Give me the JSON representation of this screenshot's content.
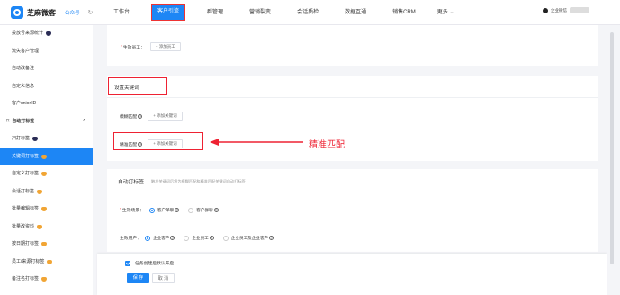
{
  "header": {
    "brand": "芝麻微客",
    "brand_sub": "公众号",
    "nav": [
      {
        "label": "工作台"
      },
      {
        "label": "客户引流"
      },
      {
        "label": "群管理"
      },
      {
        "label": "营销裂变"
      },
      {
        "label": "会话质检"
      },
      {
        "label": "数据互通"
      },
      {
        "label": "销售CRM"
      }
    ],
    "more_label": "更多",
    "user_name": "企业微信"
  },
  "sidebar": {
    "items": [
      {
        "label": "投放号来源统计",
        "badge": "dark"
      },
      {
        "label": "流失客户管理"
      },
      {
        "label": "自动改备注"
      },
      {
        "label": "自定义信息"
      },
      {
        "label": "客户unionID"
      },
      {
        "label": "自动打标签",
        "group": true
      },
      {
        "label": "扫打标签",
        "badge": "dark"
      },
      {
        "label": "关键词打标签",
        "badge": "orange",
        "active": true
      },
      {
        "label": "自定义打标签",
        "badge": "orange"
      },
      {
        "label": "会话打标签",
        "badge": "orange"
      },
      {
        "label": "批量编辑标签",
        "badge": "orange"
      },
      {
        "label": "批量改资料",
        "badge": "orange"
      },
      {
        "label": "按日期打标签",
        "badge": "orange"
      },
      {
        "label": "员工/来源打标签",
        "badge": "orange"
      },
      {
        "label": "备注名打标签",
        "badge": "orange"
      }
    ]
  },
  "main": {
    "top_card": {
      "staff_label": "生效员工：",
      "add_staff": "+ 添加员工"
    },
    "keywords_card": {
      "title": "设置关键词",
      "fuzzy_label": "模糊匹配",
      "exact_label": "精准匹配",
      "add_keyword": "+ 添加关键词"
    },
    "annotation": "精准匹配",
    "auto_tag_card": {
      "title": "自动打标签",
      "description": "触发关键词后将为模糊匹配和精准匹配关键词自动打标签",
      "scene_label": "生效场景：",
      "scene_options": [
        "客户单聊",
        "客户群聊"
      ],
      "user_label": "生效用户：",
      "user_options": [
        "企业客户",
        "企业员工",
        "企业员工及企业客户"
      ]
    },
    "footer": {
      "checkbox_label": "任务创建后默认开启",
      "save": "保 存",
      "cancel": "取 消"
    }
  }
}
